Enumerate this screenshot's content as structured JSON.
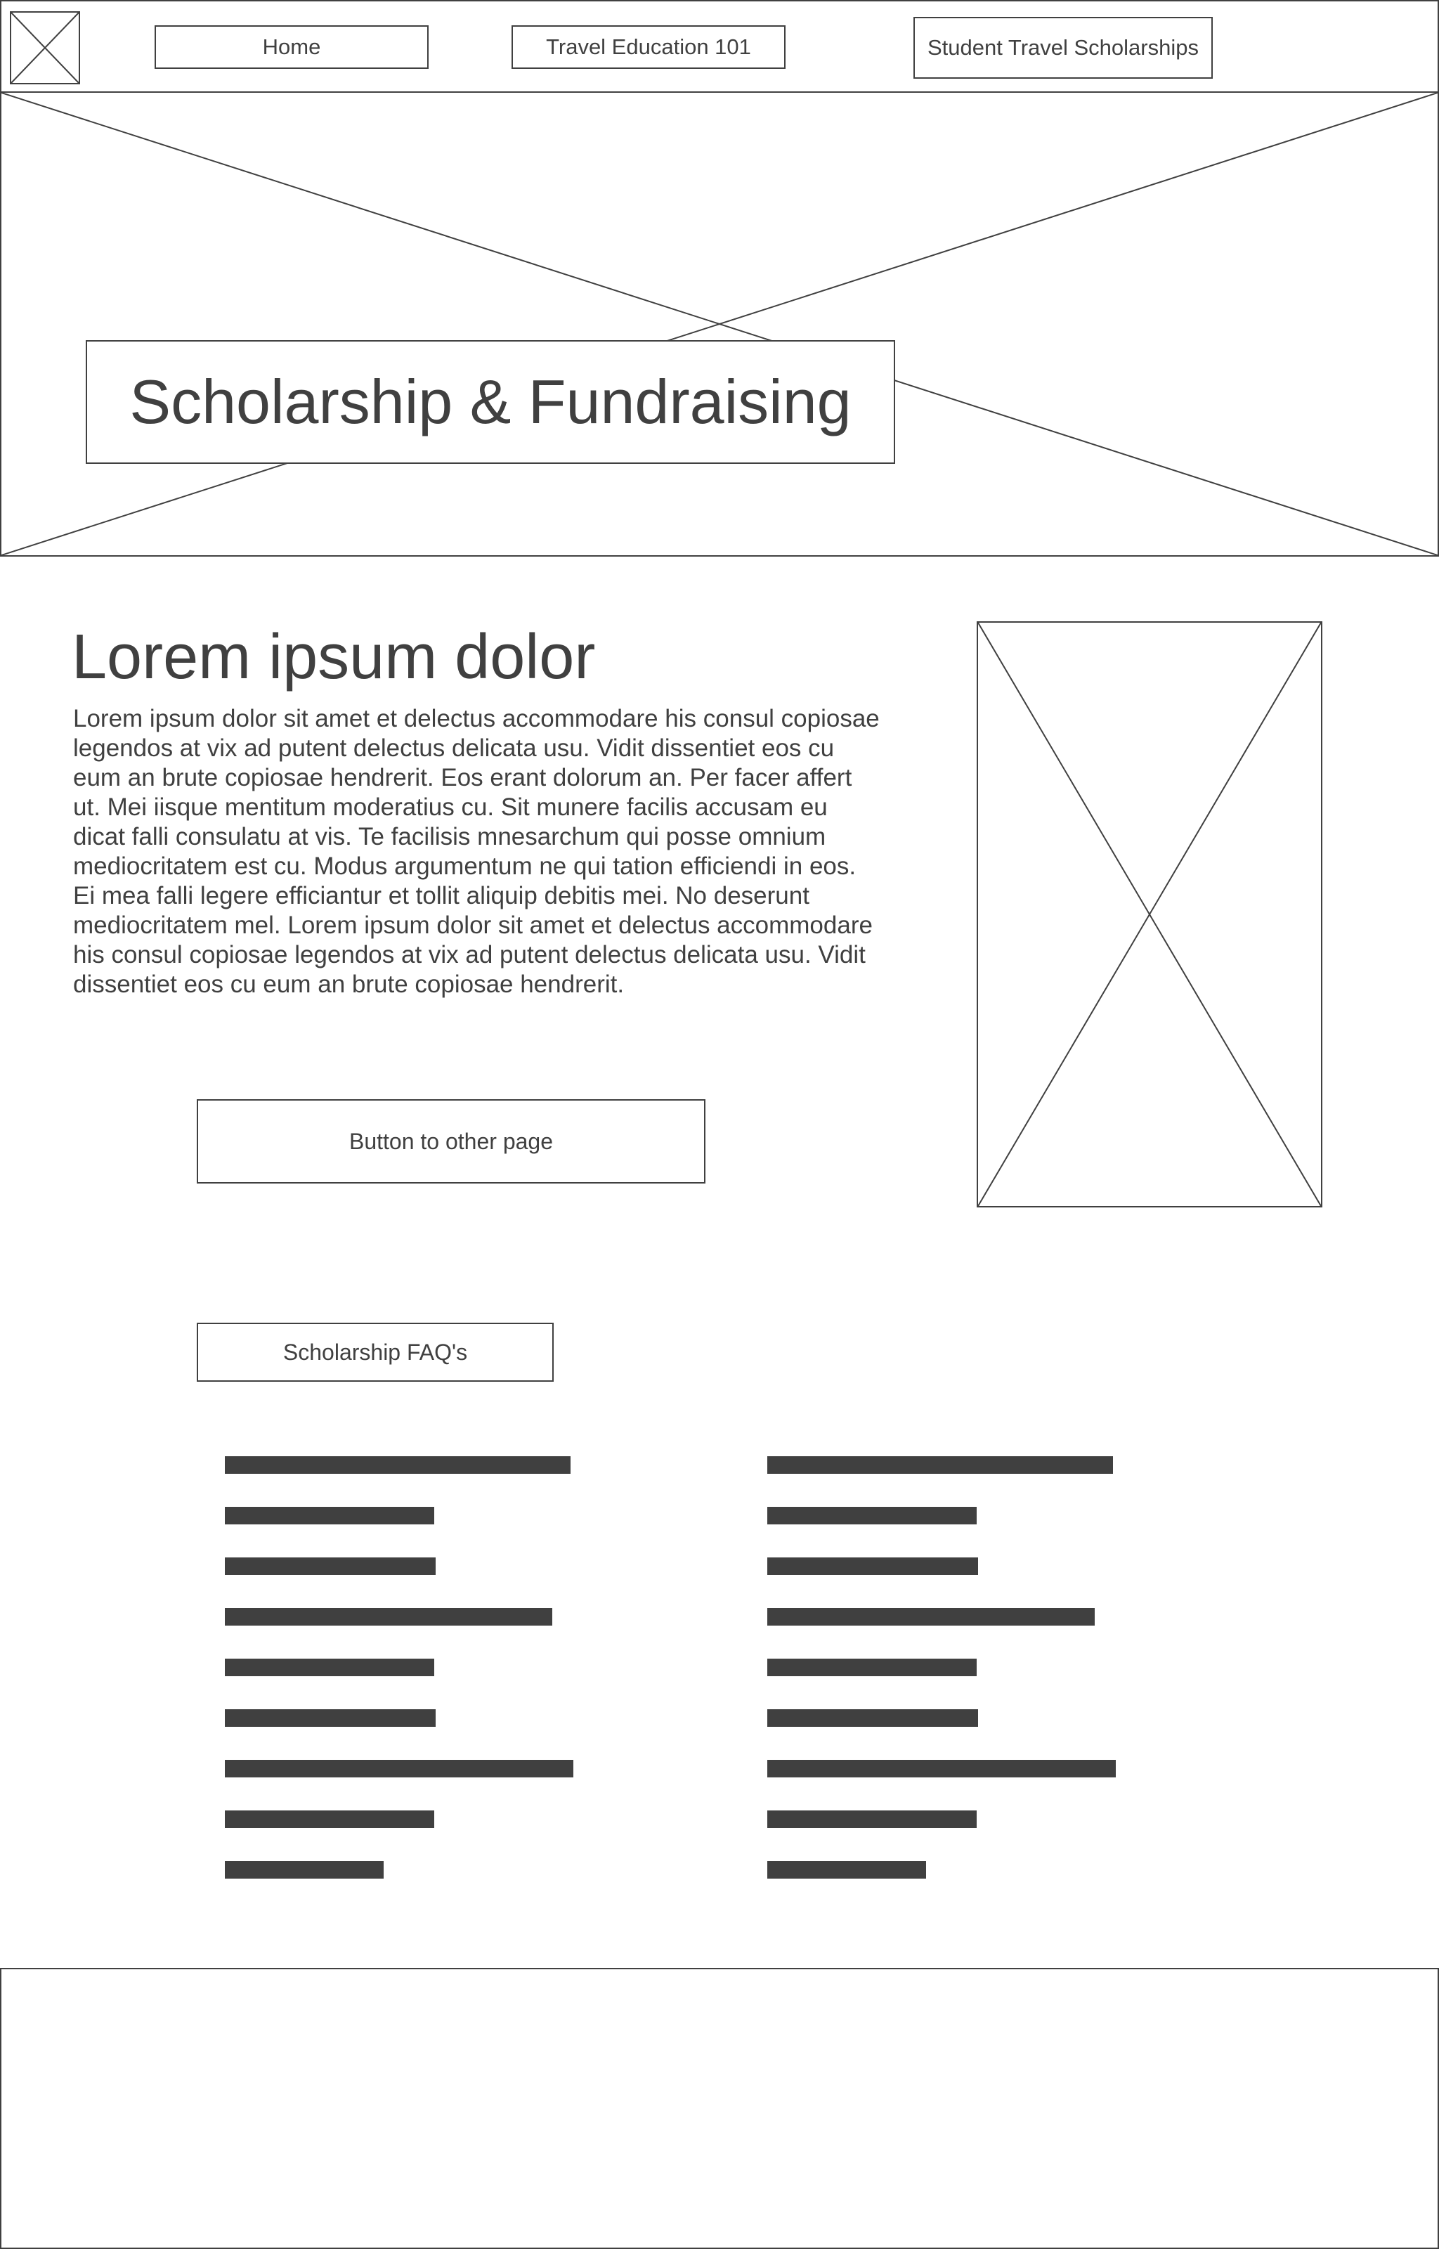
{
  "nav": {
    "logo_icon": "image-placeholder-icon",
    "items": [
      {
        "label": "Home"
      },
      {
        "label": "Travel Education 101"
      },
      {
        "label": "Student Travel Scholarships"
      }
    ]
  },
  "hero": {
    "image_icon": "image-placeholder-icon",
    "title": "Scholarship & Fundraising"
  },
  "intro": {
    "heading": "Lorem ipsum dolor",
    "paragraph_lines": [
      "Lorem ipsum dolor sit amet et delectus accommodare his consul copiosae",
      "legendos at vix ad putent delectus delicata usu. Vidit dissentiet eos cu",
      "eum an brute copiosae hendrerit. Eos erant dolorum an. Per facer affert",
      "ut. Mei iisque mentitum moderatius cu. Sit munere facilis accusam eu",
      "dicat falli consulatu at vis. Te facilisis mnesarchum qui posse omnium",
      "mediocritatem est cu. Modus argumentum ne qui tation efficiendi in eos.",
      "Ei mea falli legere efficiantur et tollit aliquip debitis mei. No deserunt",
      "mediocritatem mel. Lorem ipsum dolor sit amet et delectus accommodare",
      "his consul copiosae legendos at vix ad putent delectus delicata usu. Vidit",
      "dissentiet eos cu eum an brute copiosae hendrerit."
    ],
    "button_label": "Button to other page",
    "side_image_icon": "image-placeholder-icon"
  },
  "faq": {
    "button_label": "Scholarship FAQ's"
  },
  "colors": {
    "stroke": "#404040",
    "background": "#ffffff"
  }
}
